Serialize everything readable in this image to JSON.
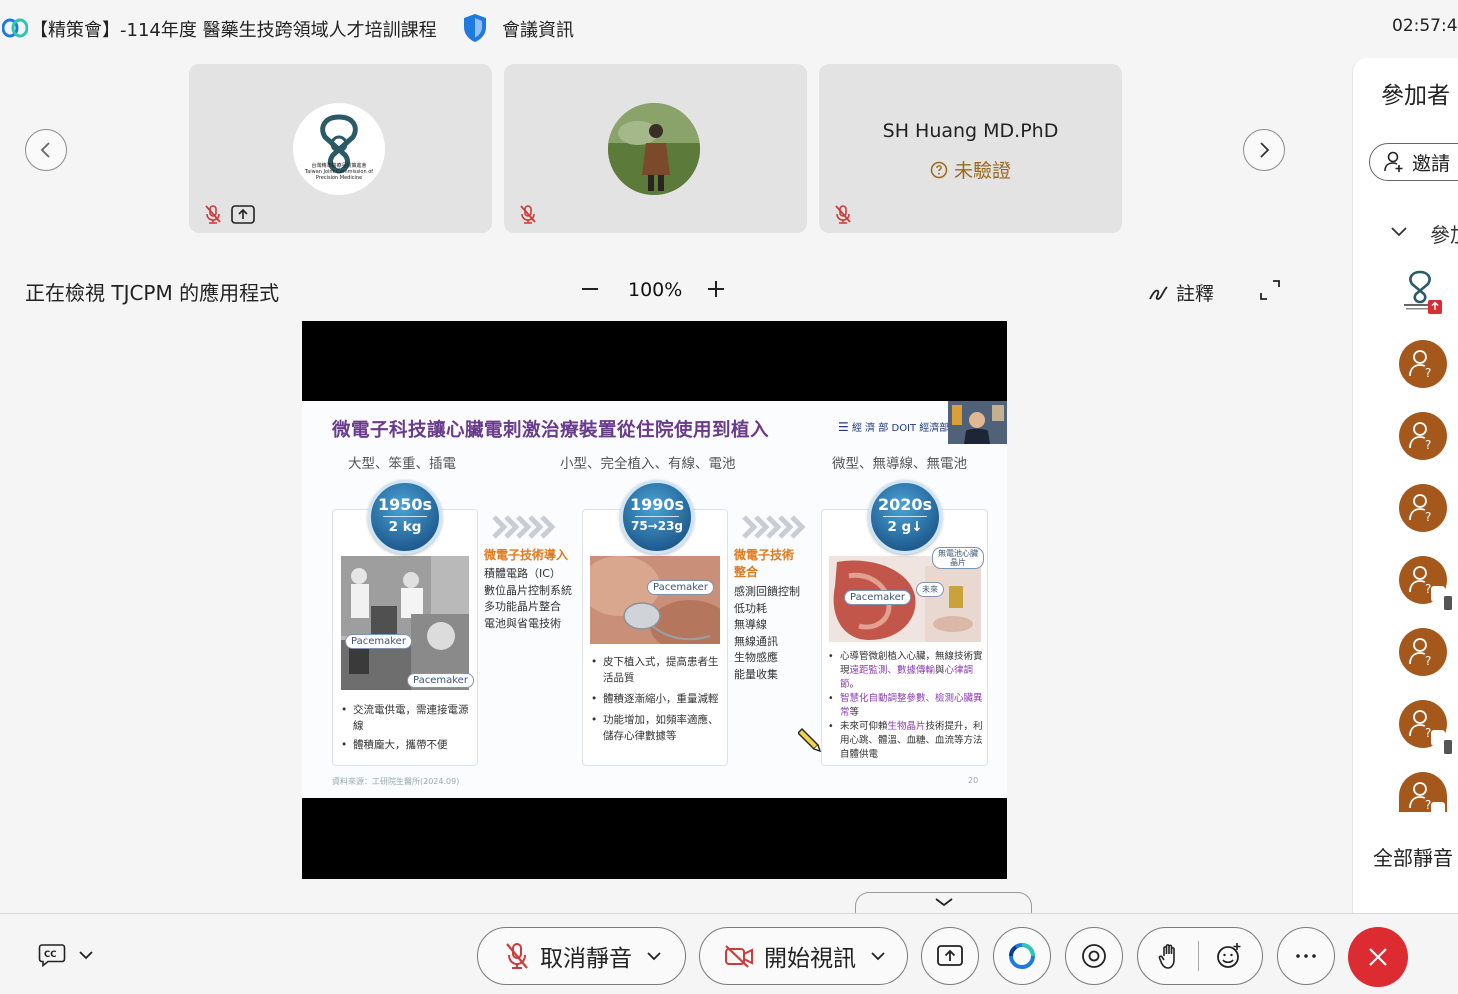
{
  "titlebar": {
    "meeting_title": "【精策會】-114年度 醫藥生技跨領域人才培訓課程",
    "meeting_info_label": "會議資訊",
    "clock": "02:57:42"
  },
  "participants_strip": {
    "tiles": [
      {
        "logo_text_1": "台灣精準醫療品質策進會",
        "logo_text_2": "Taiwan Joint Commission of",
        "logo_text_3": "Precision Medicine"
      },
      {
        "avatar": "photo"
      },
      {
        "name": "SH Huang MD.PhD",
        "status": "未驗證"
      }
    ]
  },
  "share_toolbar": {
    "sharing_label": "正在檢視 TJCPM 的應用程式",
    "zoom_level": "100%",
    "annotate_label": "註釋"
  },
  "slide": {
    "title": "微電子科技讓心臟電刺激治療裝置從住院使用到植入",
    "logos_text": "經 濟 部   DOIT 經濟部產",
    "subtitles": [
      "大型、笨重、插電",
      "小型、完全植入、有線、電池",
      "微型、無導線、無電池"
    ],
    "eras": [
      {
        "year": "1950s",
        "weight": "2 kg"
      },
      {
        "year": "1990s",
        "weight": "75→23g"
      },
      {
        "year": "2020s",
        "weight": "2 g↓"
      }
    ],
    "pacemaker_tag": "Pacemaker",
    "leadless_tag": "無電池心臟晶片",
    "future_tag": "未來",
    "card1_bullets": [
      "交流電供電，需連接電源線",
      "體積龐大，攜帶不便"
    ],
    "card2_bullets": [
      "皮下植入式，提高患者生活品質",
      "體積逐漸縮小，重量減輕",
      "功能增加，如頻率適應、儲存心律數據等"
    ],
    "card3_bullets": [
      {
        "pre": "心導管微創植入心臟，無線技術實現",
        "hl": "遠距監測、數據傳輸",
        "mid": "與",
        "hl2": "心律調節",
        "post": "。"
      },
      {
        "pre": "",
        "hl": "智慧化自動調整參數、檢測心臟異常",
        "mid": "等",
        "hl2": "",
        "post": ""
      },
      {
        "pre": "未來可仰賴",
        "hl": "生物晶片",
        "mid": "技術提升，利用心跳、體溫、血糖、血流等方法自體供電",
        "hl2": "",
        "post": ""
      }
    ],
    "mid1_head": "微電子技術導入",
    "mid1_lines": [
      "積體電路（IC）",
      "數位晶片控制系統",
      "多功能晶片整合",
      "電池與省電技術"
    ],
    "mid2_head_1": "微電子技術",
    "mid2_head_2": "整合",
    "mid2_lines": [
      "感測回饋控制",
      "低功耗",
      "無導線",
      "無線通訊",
      "生物感應",
      "能量收集"
    ],
    "footer": "資料來源：工研院生醫所(2024.09)",
    "page_number": "20"
  },
  "right_panel": {
    "title": "參加者",
    "invite_label": "邀請",
    "group_label": "參加",
    "mute_all_label": "全部靜音"
  },
  "controls": {
    "unmute_label": "取消靜音",
    "video_label": "開始視訊"
  },
  "colors": {
    "brand_accent": "#1f7ae0",
    "leave_red": "#dc2c32",
    "avatar_brown": "#a5581c",
    "slide_title_purple": "#6a3a8c",
    "mute_red": "#d03a3a"
  }
}
